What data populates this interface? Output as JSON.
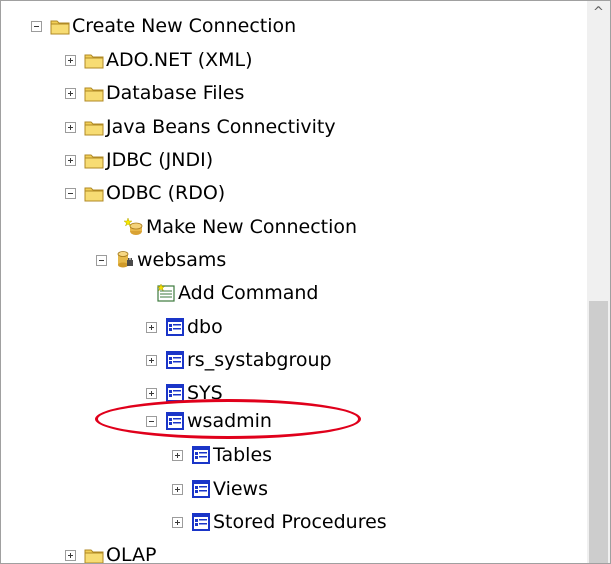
{
  "tree": {
    "items": [
      {
        "label": "Create New Connection",
        "icon": "folder-icon",
        "expander": "collapse"
      },
      {
        "label": "ADO.NET (XML)",
        "icon": "folder-icon",
        "expander": "expand"
      },
      {
        "label": "Database Files",
        "icon": "folder-icon",
        "expander": "expand"
      },
      {
        "label": "Java Beans Connectivity",
        "icon": "folder-icon",
        "expander": "expand"
      },
      {
        "label": "JDBC (JNDI)",
        "icon": "folder-icon",
        "expander": "expand"
      },
      {
        "label": "ODBC (RDO)",
        "icon": "folder-icon",
        "expander": "collapse"
      },
      {
        "label": "Make New Connection",
        "icon": "new-connection-icon",
        "expander": "none"
      },
      {
        "label": "websams",
        "icon": "database-connection-icon",
        "expander": "collapse"
      },
      {
        "label": "Add Command",
        "icon": "add-command-icon",
        "expander": "none"
      },
      {
        "label": "dbo",
        "icon": "schema-icon",
        "expander": "expand"
      },
      {
        "label": "rs_systabgroup",
        "icon": "schema-icon",
        "expander": "expand"
      },
      {
        "label": "SYS",
        "icon": "schema-icon",
        "expander": "expand"
      },
      {
        "label": "wsadmin",
        "icon": "schema-icon",
        "expander": "collapse"
      },
      {
        "label": "Tables",
        "icon": "schema-icon",
        "expander": "expand"
      },
      {
        "label": "Views",
        "icon": "schema-icon",
        "expander": "expand"
      },
      {
        "label": "Stored Procedures",
        "icon": "schema-icon",
        "expander": "expand"
      },
      {
        "label": "OLAP",
        "icon": "folder-icon",
        "expander": "expand"
      }
    ]
  },
  "scrollbar": {
    "up_arrow": "^"
  },
  "colors": {
    "highlight": "#e0001b",
    "folder": "#f2cf57",
    "schema": "#1a35c8"
  }
}
